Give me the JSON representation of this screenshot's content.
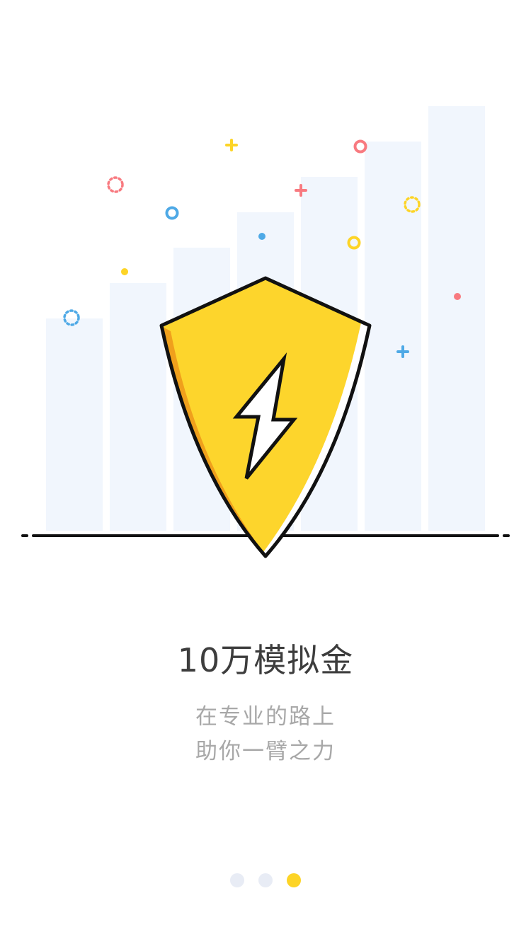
{
  "onboarding": {
    "title": "10万模拟金",
    "subtitle_line1": "在专业的路上",
    "subtitle_line2": "助你一臂之力"
  },
  "illustration": {
    "icon": "shield-lightning-icon",
    "bar_color": "#f1f6fd",
    "shield_color": "#fdd52c",
    "shield_shade_color": "#f0a01c",
    "accent_colors": [
      "#fdd426",
      "#f87a80",
      "#4ea9e6"
    ]
  },
  "pager": {
    "page_count": 3,
    "current_page": 3,
    "active_color": "#fdd426",
    "inactive_color": "#e8ecf5"
  }
}
